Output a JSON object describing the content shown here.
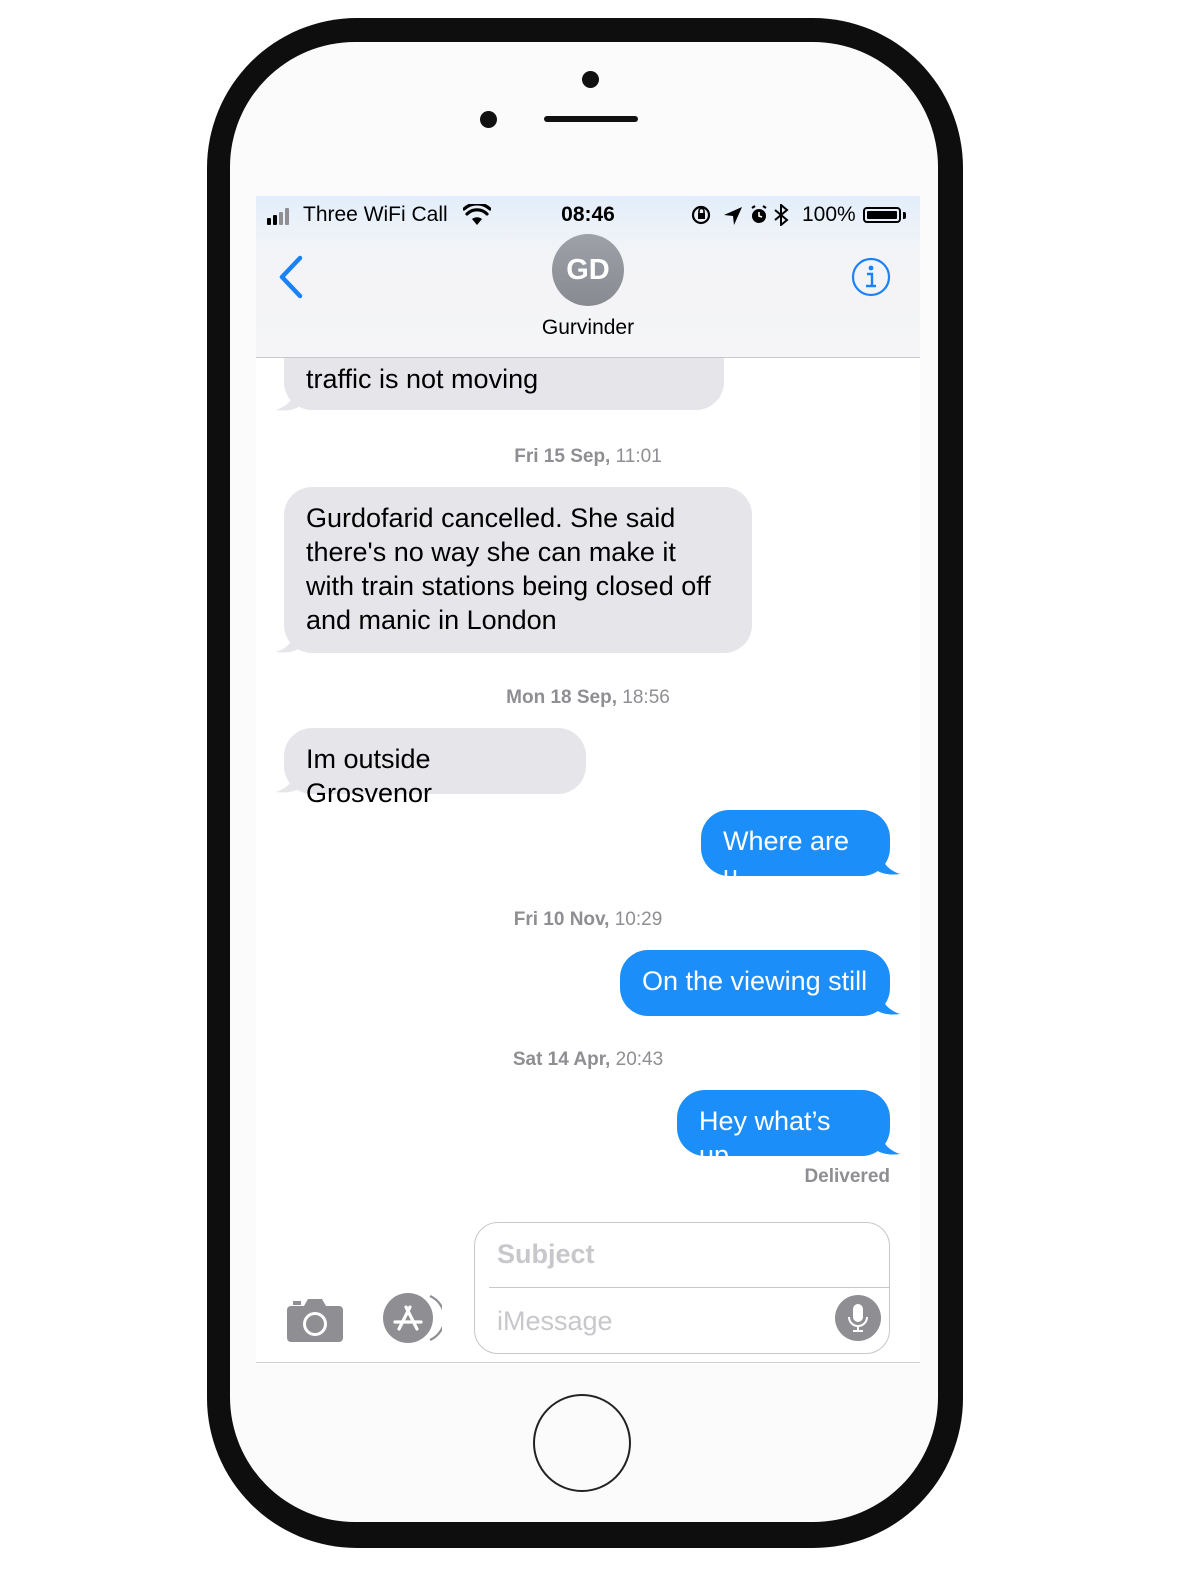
{
  "status_bar": {
    "carrier": "Three WiFi Call",
    "time": "08:46",
    "battery": "100%",
    "icons": [
      "signal-icon",
      "wifi-icon",
      "orientation-lock-icon",
      "location-icon",
      "alarm-icon",
      "bluetooth-icon",
      "battery-icon"
    ]
  },
  "header": {
    "avatar_initials": "GD",
    "contact_name": "Gurvinder"
  },
  "messages": [
    {
      "dir": "in",
      "text": "traffic is not moving"
    },
    {
      "dir": "in",
      "text": "Gurdofarid cancelled. She said\nthere's no way she can make it\nwith train stations being closed off\nand manic in London"
    },
    {
      "dir": "in",
      "text": "Im outside Grosvenor"
    },
    {
      "dir": "out",
      "text": "Where are u"
    },
    {
      "dir": "out",
      "text": "On the viewing still"
    },
    {
      "dir": "out",
      "text": "Hey what’s up"
    }
  ],
  "timestamps": [
    {
      "day": "Fri 15 Sep,",
      "time": " 11:01"
    },
    {
      "day": "Mon 18 Sep,",
      "time": " 18:56"
    },
    {
      "day": "Fri 10 Nov,",
      "time": " 10:29"
    },
    {
      "day": "Sat 14 Apr,",
      "time": " 20:43"
    }
  ],
  "delivered": "Delivered",
  "composer": {
    "subject_placeholder": "Subject",
    "message_placeholder": "iMessage"
  },
  "colors": {
    "outgoing": "#1c8efa",
    "incoming": "#e5e5ea",
    "accent": "#1a82f7"
  }
}
